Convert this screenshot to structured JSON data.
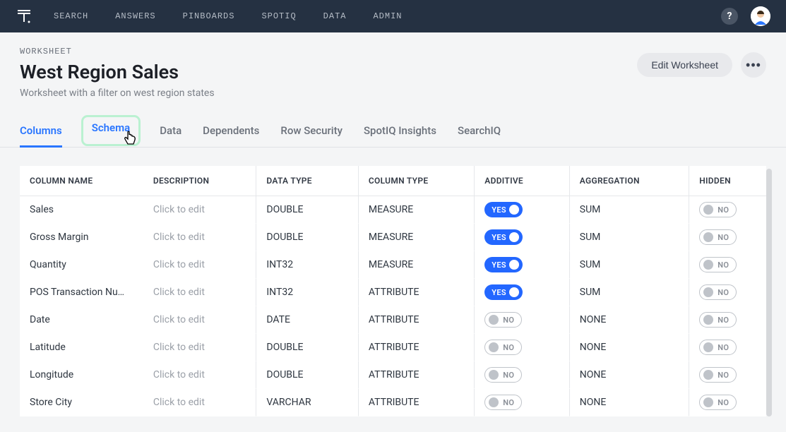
{
  "nav": {
    "items": [
      "SEARCH",
      "ANSWERS",
      "PINBOARDS",
      "SPOTIQ",
      "DATA",
      "ADMIN"
    ],
    "help": "?"
  },
  "header": {
    "eyebrow": "WORKSHEET",
    "title": "West Region Sales",
    "subtitle": "Worksheet with a filter on west region states",
    "edit_label": "Edit Worksheet",
    "more_label": "•••"
  },
  "tabs": [
    "Columns",
    "Schema",
    "Data",
    "Dependents",
    "Row Security",
    "SpotIQ Insights",
    "SearchIQ"
  ],
  "tabs_active_index": 0,
  "tabs_hover_index": 1,
  "table": {
    "headers": [
      "COLUMN NAME",
      "DESCRIPTION",
      "DATA TYPE",
      "COLUMN TYPE",
      "ADDITIVE",
      "AGGREGATION",
      "HIDDEN"
    ],
    "desc_placeholder": "Click to edit",
    "toggle_labels": {
      "on": "YES",
      "off": "NO"
    },
    "rows": [
      {
        "name": "Sales",
        "data_type": "DOUBLE",
        "column_type": "MEASURE",
        "additive": true,
        "aggregation": "SUM",
        "hidden": false
      },
      {
        "name": "Gross Margin",
        "data_type": "DOUBLE",
        "column_type": "MEASURE",
        "additive": true,
        "aggregation": "SUM",
        "hidden": false
      },
      {
        "name": "Quantity",
        "data_type": "INT32",
        "column_type": "MEASURE",
        "additive": true,
        "aggregation": "SUM",
        "hidden": false
      },
      {
        "name": "POS Transaction Nu…",
        "data_type": "INT32",
        "column_type": "ATTRIBUTE",
        "additive": true,
        "aggregation": "SUM",
        "hidden": false
      },
      {
        "name": "Date",
        "data_type": "DATE",
        "column_type": "ATTRIBUTE",
        "additive": false,
        "aggregation": "NONE",
        "hidden": false
      },
      {
        "name": "Latitude",
        "data_type": "DOUBLE",
        "column_type": "ATTRIBUTE",
        "additive": false,
        "aggregation": "NONE",
        "hidden": false
      },
      {
        "name": "Longitude",
        "data_type": "DOUBLE",
        "column_type": "ATTRIBUTE",
        "additive": false,
        "aggregation": "NONE",
        "hidden": false
      },
      {
        "name": "Store City",
        "data_type": "VARCHAR",
        "column_type": "ATTRIBUTE",
        "additive": false,
        "aggregation": "NONE",
        "hidden": false
      }
    ]
  }
}
